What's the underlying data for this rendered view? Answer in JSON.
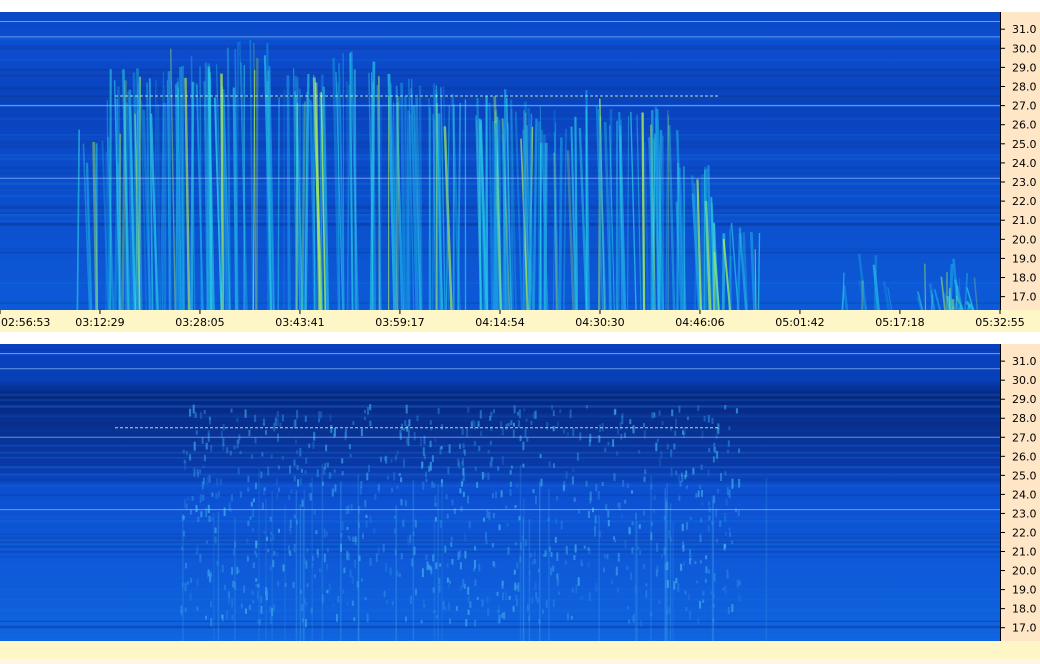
{
  "chart_data": [
    {
      "type": "heatmap",
      "title": "",
      "xlabel": "",
      "ylabel": "",
      "x_tick_labels": [
        "02:56:53",
        "03:12:29",
        "03:28:05",
        "03:43:41",
        "03:59:17",
        "04:14:54",
        "04:30:30",
        "04:46:06",
        "05:01:42",
        "05:17:18",
        "05:32:55"
      ],
      "y_tick_labels": [
        "31.0",
        "30.0",
        "29.0",
        "28.0",
        "27.0",
        "26.0",
        "25.0",
        "24.0",
        "23.0",
        "22.0",
        "21.0",
        "20.0",
        "19.0",
        "18.0",
        "17.0"
      ],
      "ylim": [
        16.3,
        31.9
      ],
      "xlim": [
        "02:56:53",
        "05:32:55"
      ],
      "colors": {
        "background": "#0a52d0",
        "dark_band": "#0838a8",
        "bursts": "#2fd0e8",
        "hot": "#c8ff40"
      },
      "burst_columns_time": [
        "03:12:00",
        "03:16:30",
        "03:20:00",
        "03:26:00",
        "03:30:30",
        "03:36:00",
        "03:42:00",
        "03:46:30",
        "03:52:00",
        "03:58:00",
        "04:02:30",
        "04:08:00",
        "04:13:00",
        "04:17:00",
        "04:21:00",
        "04:25:00",
        "04:32:00",
        "04:36:30",
        "04:41:00",
        "04:46:00",
        "04:52:00",
        "05:12:00",
        "05:22:00",
        "05:25:30"
      ],
      "burst_top_freq": [
        26.0,
        29.0,
        28.5,
        30.0,
        29.5,
        30.5,
        29.0,
        29.0,
        30.0,
        29.0,
        28.5,
        28.0,
        28.0,
        27.5,
        27.0,
        26.5,
        28.0,
        27.0,
        27.0,
        24.0,
        21.0,
        19.5,
        19.0,
        18.5
      ]
    },
    {
      "type": "heatmap",
      "title": "",
      "xlabel": "",
      "ylabel": "",
      "y_tick_labels": [
        "31.0",
        "30.0",
        "29.0",
        "28.0",
        "27.0",
        "26.0",
        "25.0",
        "24.0",
        "23.0",
        "22.0",
        "21.0",
        "20.0",
        "19.0",
        "18.0",
        "17.0"
      ],
      "ylim": [
        16.3,
        31.9
      ],
      "xlim": [
        "02:56:53",
        "05:32:55"
      ],
      "colors": {
        "background": "#0c4fd0",
        "dark_band": "#07267e",
        "bursts": "#3fb8ee"
      }
    }
  ]
}
